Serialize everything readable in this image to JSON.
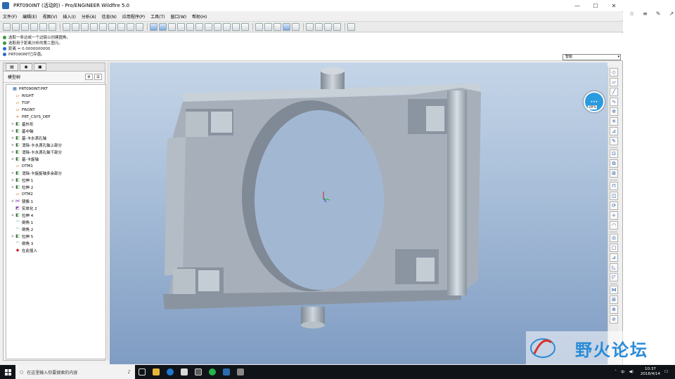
{
  "window": {
    "title": "PRT090INT (活动的) - Pro/ENGINEER Wildfire 5.0",
    "min": "—",
    "max": "☐",
    "close": "✕"
  },
  "menu": [
    "文件(F)",
    "编辑(E)",
    "视图(V)",
    "插入(I)",
    "分析(A)",
    "信息(N)",
    "应用程序(P)",
    "工具(T)",
    "窗口(W)",
    "帮助(H)"
  ],
  "messages": [
    {
      "text": "选取一条边或一个边链以创建圆角。",
      "icon": "green"
    },
    {
      "text": "选取用于距离分析的第二图元。",
      "icon": "green"
    },
    {
      "text": "距离 = 0.0000000000",
      "icon": "blue"
    },
    {
      "text": "PRT090INT已存盘。",
      "icon": "blue"
    }
  ],
  "filter": {
    "value": "智能",
    "arrow": "▾"
  },
  "tree": {
    "header": "模型树",
    "items": [
      {
        "label": "PRT090INT.PRT",
        "exp": "",
        "icon": "▦",
        "color": "#3366aa",
        "indent": 0
      },
      {
        "label": "RIGHT",
        "exp": "",
        "icon": "▱",
        "color": "#cc6600",
        "indent": 1
      },
      {
        "label": "TOP",
        "exp": "",
        "icon": "▱",
        "color": "#cc6600",
        "indent": 1
      },
      {
        "label": "FRONT",
        "exp": "",
        "icon": "▱",
        "color": "#cc6600",
        "indent": 1
      },
      {
        "label": "PRT_CSYS_DEF",
        "exp": "",
        "icon": "⟡",
        "color": "#cc6600",
        "indent": 1
      },
      {
        "label": "基外形",
        "exp": "+",
        "icon": "◧",
        "color": "#3a7a3a",
        "indent": 1
      },
      {
        "label": "基中轴",
        "exp": "+",
        "icon": "◧",
        "color": "#3a7a3a",
        "indent": 1
      },
      {
        "label": "基-卡水滴孔轴",
        "exp": "+",
        "icon": "◧",
        "color": "#3a7a3a",
        "indent": 1
      },
      {
        "label": "消除-卡水滴孔轴上部分",
        "exp": "+",
        "icon": "◧",
        "color": "#3a7a3a",
        "indent": 1
      },
      {
        "label": "消除-卡水滴孔轴下部分",
        "exp": "+",
        "icon": "◧",
        "color": "#3a7a3a",
        "indent": 1
      },
      {
        "label": "基-卡旋轴",
        "exp": "+",
        "icon": "◧",
        "color": "#3a7a3a",
        "indent": 1
      },
      {
        "label": "DTM1",
        "exp": "",
        "icon": "▱",
        "color": "#cc6600",
        "indent": 1
      },
      {
        "label": "消除-卡旋旋轴多余部分",
        "exp": "+",
        "icon": "◧",
        "color": "#3a7a3a",
        "indent": 1
      },
      {
        "label": "拉伸 1",
        "exp": "+",
        "icon": "◧",
        "color": "#3a7a3a",
        "indent": 1
      },
      {
        "label": "拉伸 2",
        "exp": "+",
        "icon": "◧",
        "color": "#3a7a3a",
        "indent": 1
      },
      {
        "label": "DTM2",
        "exp": "",
        "icon": "▱",
        "color": "#cc6600",
        "indent": 1
      },
      {
        "label": "镜像 1",
        "exp": "+",
        "icon": "⋈",
        "color": "#8844aa",
        "indent": 1
      },
      {
        "label": "实体化 2",
        "exp": "",
        "icon": "◩",
        "color": "#8844aa",
        "indent": 1
      },
      {
        "label": "拉伸 4",
        "exp": "+",
        "icon": "◧",
        "color": "#3a7a3a",
        "indent": 1
      },
      {
        "label": "倒角 1",
        "exp": "",
        "icon": "◠",
        "color": "#2a8a8a",
        "indent": 1
      },
      {
        "label": "倒角 2",
        "exp": "",
        "icon": "◠",
        "color": "#2a8a8a",
        "indent": 1
      },
      {
        "label": "拉伸 5",
        "exp": "+",
        "icon": "◧",
        "color": "#3a7a3a",
        "indent": 1
      },
      {
        "label": "倒角 3",
        "exp": "",
        "icon": "◠",
        "color": "#2a8a8a",
        "indent": 1
      },
      {
        "label": "在此插入",
        "exp": "",
        "icon": "◆",
        "color": "#cc2222",
        "indent": 1
      }
    ]
  },
  "badge": {
    "pct": "28%"
  },
  "watermark": {
    "text": "野火论坛"
  },
  "taskbar": {
    "search_placeholder": "在这里输入你要搜索的内容",
    "time": "10:37",
    "date": "2018/4/14",
    "ime": "中"
  },
  "rightstrip": {
    "icons": [
      "☆",
      "≡",
      "✎",
      "↗"
    ]
  },
  "colors": {
    "viewport_top": "#c5d5e8",
    "viewport_bottom": "#7f9cc3",
    "model_gray": "#a9b2bb",
    "accent": "#2b6cb0"
  }
}
